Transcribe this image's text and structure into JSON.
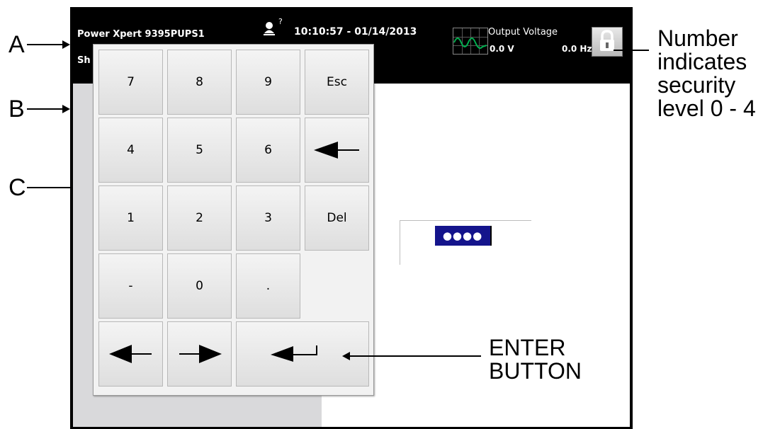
{
  "annotations": {
    "a": "A",
    "b": "B",
    "c": "C",
    "security_note": [
      "Number",
      "indicates",
      "security",
      "level 0 - 4"
    ],
    "enter_note": [
      "ENTER",
      "BUTTON"
    ]
  },
  "status_bar": {
    "device_name": "Power Xpert 9395PUPS1",
    "help_glyph": "?",
    "datetime": "10:10:57 - 01/14/2013",
    "meter_title": "Output Voltage",
    "voltage": "0.0 V",
    "frequency": "0.0 Hz",
    "menu_partial": "Sh"
  },
  "keypad": {
    "rows": [
      [
        "7",
        "8",
        "9",
        "Esc"
      ],
      [
        "4",
        "5",
        "6",
        ""
      ],
      [
        "1",
        "2",
        "3",
        "Del"
      ],
      [
        "-",
        "0",
        "."
      ]
    ]
  },
  "password": {
    "masked_value": "●●●●"
  },
  "colors": {
    "status_bar_bg": "#000000",
    "left_panel_bg": "#d9d9db",
    "password_field_bg": "#14148c",
    "waveform": "#00b050"
  },
  "icons": {
    "user_help": "user-help-icon",
    "waveform": "waveform-icon",
    "lock": "lock-icon",
    "backspace": "left-arrow-icon",
    "cursor_left": "left-arrow-icon",
    "cursor_right": "right-arrow-icon",
    "enter": "enter-return-icon"
  }
}
